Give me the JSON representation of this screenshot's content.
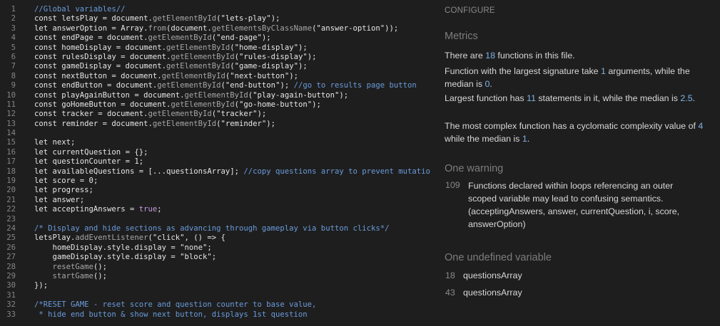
{
  "code": {
    "lines": [
      {
        "n": "1",
        "html": "<span class=\"c\">//Global variables//</span>"
      },
      {
        "n": "2",
        "html": "<span class=\"k\">const</span> letsPlay = document.<span class=\"f\">getElementById</span>(<span class=\"s\">\"lets-play\"</span>);"
      },
      {
        "n": "3",
        "html": "<span class=\"k\">let</span> answerOption = Array.<span class=\"f\">from</span>(document.<span class=\"f\">getElementsByClassName</span>(<span class=\"s\">\"answer-option\"</span>));"
      },
      {
        "n": "4",
        "html": "<span class=\"k\">const</span> endPage = document.<span class=\"f\">getElementById</span>(<span class=\"s\">\"end-page\"</span>);"
      },
      {
        "n": "5",
        "html": "<span class=\"k\">const</span> homeDisplay = document.<span class=\"f\">getElementById</span>(<span class=\"s\">\"home-display\"</span>);"
      },
      {
        "n": "6",
        "html": "<span class=\"k\">const</span> rulesDisplay = document.<span class=\"f\">getElementById</span>(<span class=\"s\">\"rules-display\"</span>);"
      },
      {
        "n": "7",
        "html": "<span class=\"k\">const</span> gameDisplay = document.<span class=\"f\">getElementById</span>(<span class=\"s\">\"game-display\"</span>);"
      },
      {
        "n": "8",
        "html": "<span class=\"k\">const</span> nextButton = document.<span class=\"f\">getElementById</span>(<span class=\"s\">\"next-button\"</span>);"
      },
      {
        "n": "9",
        "html": "<span class=\"k\">const</span> endButton = document.<span class=\"f\">getElementById</span>(<span class=\"s\">\"end-button\"</span>); <span class=\"c\">//go to results page button</span>"
      },
      {
        "n": "10",
        "html": "<span class=\"k\">const</span> playAgainButton = document.<span class=\"f\">getElementById</span>(<span class=\"s\">\"play-again-button\"</span>);"
      },
      {
        "n": "11",
        "html": "<span class=\"k\">const</span> goHomeButton = document.<span class=\"f\">getElementById</span>(<span class=\"s\">\"go-home-button\"</span>);"
      },
      {
        "n": "12",
        "html": "<span class=\"k\">const</span> tracker = document.<span class=\"f\">getElementById</span>(<span class=\"s\">\"tracker\"</span>);"
      },
      {
        "n": "13",
        "html": "<span class=\"k\">const</span> reminder = document.<span class=\"f\">getElementById</span>(<span class=\"s\">\"reminder\"</span>);"
      },
      {
        "n": "14",
        "html": ""
      },
      {
        "n": "15",
        "html": "<span class=\"k\">let</span> next;"
      },
      {
        "n": "16",
        "html": "<span class=\"k\">let</span> currentQuestion = {};"
      },
      {
        "n": "17",
        "html": "<span class=\"k\">let</span> questionCounter = <span class=\"n\">1</span>;"
      },
      {
        "n": "18",
        "html": "<span class=\"k\">let</span> availableQuestions = [...questionsArray]; <span class=\"c\">//copy questions array to prevent mutation o</span>"
      },
      {
        "n": "19",
        "html": "<span class=\"k\">let</span> score = <span class=\"n\">0</span>;"
      },
      {
        "n": "20",
        "html": "<span class=\"k\">let</span> progress;"
      },
      {
        "n": "21",
        "html": "<span class=\"k\">let</span> answer;"
      },
      {
        "n": "22",
        "html": "<span class=\"k\">let</span> acceptingAnswers = <span class=\"b\">true</span>;"
      },
      {
        "n": "23",
        "html": ""
      },
      {
        "n": "24",
        "html": "<span class=\"c\">/* Display and hide sections as advancing through gameplay via button clicks*/</span>"
      },
      {
        "n": "25",
        "html": "letsPlay.<span class=\"f\">addEventListener</span>(<span class=\"s\">\"click\"</span>, () =&gt; {"
      },
      {
        "n": "26",
        "html": "    homeDisplay.style.display = <span class=\"s\">\"none\"</span>;"
      },
      {
        "n": "27",
        "html": "    gameDisplay.style.display = <span class=\"s\">\"block\"</span>;"
      },
      {
        "n": "28",
        "html": "    <span class=\"f\">resetGame</span>();"
      },
      {
        "n": "29",
        "html": "    <span class=\"f\">startGame</span>();"
      },
      {
        "n": "30",
        "html": "});"
      },
      {
        "n": "31",
        "html": ""
      },
      {
        "n": "32",
        "html": "<span class=\"c\">/*RESET GAME - reset score and question counter to base value,</span>"
      },
      {
        "n": "33",
        "html": "<span class=\"c\"> * hide end button &amp; show next button, displays 1st question</span>"
      }
    ]
  },
  "panel": {
    "configure": "CONFIGURE",
    "metrics": {
      "title": "Metrics",
      "p1_a": "There are ",
      "p1_num": "18",
      "p1_b": " functions in this file.",
      "p2_a": "Function with the largest signature take ",
      "p2_num1": "1",
      "p2_b": " arguments, while the median is ",
      "p2_num2": "0",
      "p2_c": ".",
      "p3_a": "Largest function has ",
      "p3_num1": "11",
      "p3_b": " statements in it, while the median is ",
      "p3_num2": "2.5",
      "p3_c": ".",
      "p4_a": "The most complex function has a cyclomatic complexity value of ",
      "p4_num1": "4",
      "p4_b": " while the median is ",
      "p4_num2": "1",
      "p4_c": "."
    },
    "warning": {
      "title": "One warning",
      "line": "109",
      "text": "Functions declared within loops referencing an outer scoped variable may lead to confusing semantics. (acceptingAnswers, answer, currentQuestion, i, score, answerOption)"
    },
    "undefined": {
      "title": "One undefined variable",
      "items": [
        {
          "line": "18",
          "name": "questionsArray"
        },
        {
          "line": "43",
          "name": "questionsArray"
        }
      ]
    }
  },
  "colors": {
    "background": "#1e1e1e",
    "comment": "#6a9bdb",
    "highlight": "#7fb2e6",
    "boolean": "#c89bdf"
  }
}
